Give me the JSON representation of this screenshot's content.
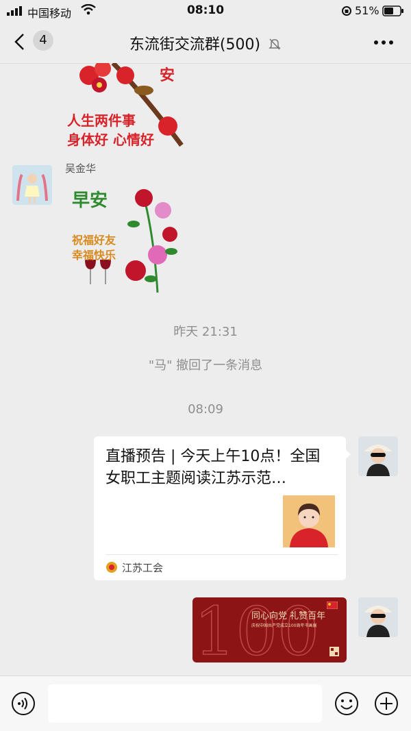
{
  "status_bar": {
    "carrier": "中国移动",
    "time": "08:10",
    "battery": "51%"
  },
  "nav": {
    "back_count": "4",
    "title": "东流街交流群(500)"
  },
  "messages": {
    "sticker1": {
      "text1": "安",
      "text2": "人生两件事",
      "text3": "身体好  心情好"
    },
    "sender_name": "吴金华",
    "sticker2": {
      "text1": "早安",
      "text2": "祝福好友",
      "text3": "幸福快乐"
    },
    "ts1": "昨天 21:31",
    "recall": "\"马\" 撤回了一条消息",
    "ts2": "08:09",
    "card": {
      "title": "直播预告 | 今天上午10点！全国女职工主题阅读江苏示范…",
      "source": "江苏工会"
    },
    "image": {
      "title": "同心向党  礼赞百年",
      "subtitle": "庆祝中国共产党成立100周年书画展",
      "big": "100"
    }
  },
  "colors": {
    "accent_red": "#d8232a",
    "rose": "#c0152a",
    "leaf": "#2f8a2f"
  }
}
